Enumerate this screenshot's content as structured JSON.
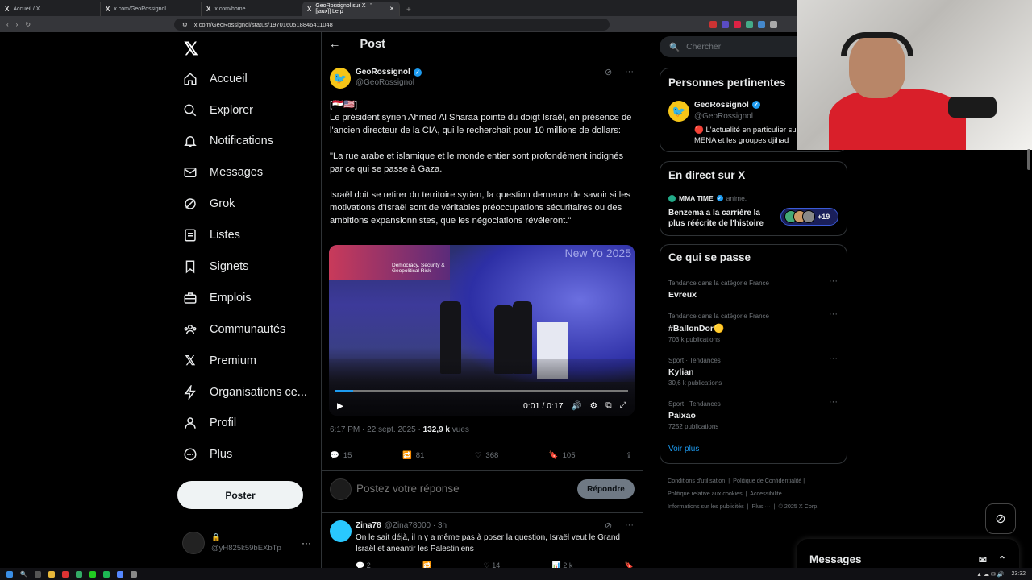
{
  "browser": {
    "tabs": [
      {
        "label": "Accueil / X",
        "active": false
      },
      {
        "label": "x.com/GeoRossignol",
        "active": false
      },
      {
        "label": "x.com/home",
        "active": false
      },
      {
        "label": "GeoRossignol sur X : \"[jaux]] Le p",
        "active": true
      }
    ],
    "url": "x.com/GeoRossignol/status/1970160518846411048"
  },
  "nav": {
    "items": [
      "Accueil",
      "Explorer",
      "Notifications",
      "Messages",
      "Grok",
      "Listes",
      "Signets",
      "Emplois",
      "Communautés",
      "Premium",
      "Organisations ce...",
      "Profil",
      "Plus"
    ],
    "post_button": "Poster",
    "account_handle": "@yH825k59bEXbTp"
  },
  "header": {
    "title": "Post"
  },
  "tweet": {
    "name": "GeoRossignol",
    "handle": "@GeoRossignol",
    "flags": "[🇪🇬🇺🇸]",
    "para1": "Le président syrien Ahmed Al Sharaa pointe du doigt Israël, en présence de l'ancien directeur de la CIA, qui le recherchait pour 10 millions de dollars:",
    "para2": "\"La rue arabe et islamique et le monde entier sont profondément indignés par ce qui se passe à Gaza.",
    "para3": "Israël doit se retirer du territoire syrien, la question demeure de savoir si les motivations d'Israël sont de véritables préoccupations sécuritaires ou des ambitions expansionnistes, que les négociations révéleront.\"",
    "video": {
      "sign_text": "Democracy, Security & Geopolitical Risk",
      "corner_text": "New Yo 2025",
      "time": "0:01 / 0:17",
      "progress": 0.06
    },
    "time": "6:17 PM · 22 sept. 2025 · ",
    "views": "132,9 k",
    "views_label": " vues",
    "stats": {
      "replies": "15",
      "reposts": "81",
      "likes": "368",
      "bookmarks": "105"
    }
  },
  "reply": {
    "placeholder": "Postez votre réponse",
    "button": "Répondre"
  },
  "comment": {
    "name": "Zina78",
    "handle": "@Zina78000 · 3h",
    "text": "On le sait déjà, il n y a même pas à poser la question, Israël veut le Grand Israël et aneantir les Palestiniens",
    "stats": {
      "replies": "2",
      "likes": "14",
      "views": "2 k"
    }
  },
  "right": {
    "search_placeholder": "Chercher",
    "persons": {
      "title": "Personnes pertinentes",
      "name": "GeoRossignol",
      "handle": "@GeoRossignol",
      "bio": "🔴 L'actualité en particulier sur MENA et les groupes djihad"
    },
    "live": {
      "title": "En direct sur X",
      "host": "MMA TIME",
      "host_note": "anime.",
      "text": "Benzema a la carrière la plus réécrite de l'histoire",
      "count": "+19"
    },
    "trends": {
      "title": "Ce qui se passe",
      "items": [
        {
          "cat": "Tendance dans la catégorie France",
          "name": "Evreux",
          "count": ""
        },
        {
          "cat": "Tendance dans la catégorie France",
          "name": "#BallonDor🟡",
          "count": "703 k publications"
        },
        {
          "cat": "Sport · Tendances",
          "name": "Kylian",
          "count": "30,6 k publications"
        },
        {
          "cat": "Sport · Tendances",
          "name": "Paixao",
          "count": "7252 publications"
        }
      ],
      "more": "Voir plus"
    },
    "footer": [
      "Conditions d'utilisation",
      "Politique de Confidentialité",
      "Politique relative aux cookies",
      "Accessibilité",
      "Informations sur les publicités",
      "Plus ···",
      "© 2025 X Corp."
    ]
  },
  "dock": {
    "title": "Messages"
  },
  "taskbar": {
    "time": "23:32"
  },
  "colors": {
    "accent": "#1d9bf0",
    "background": "#000000",
    "border": "#2f3336",
    "muted": "#71767b"
  }
}
